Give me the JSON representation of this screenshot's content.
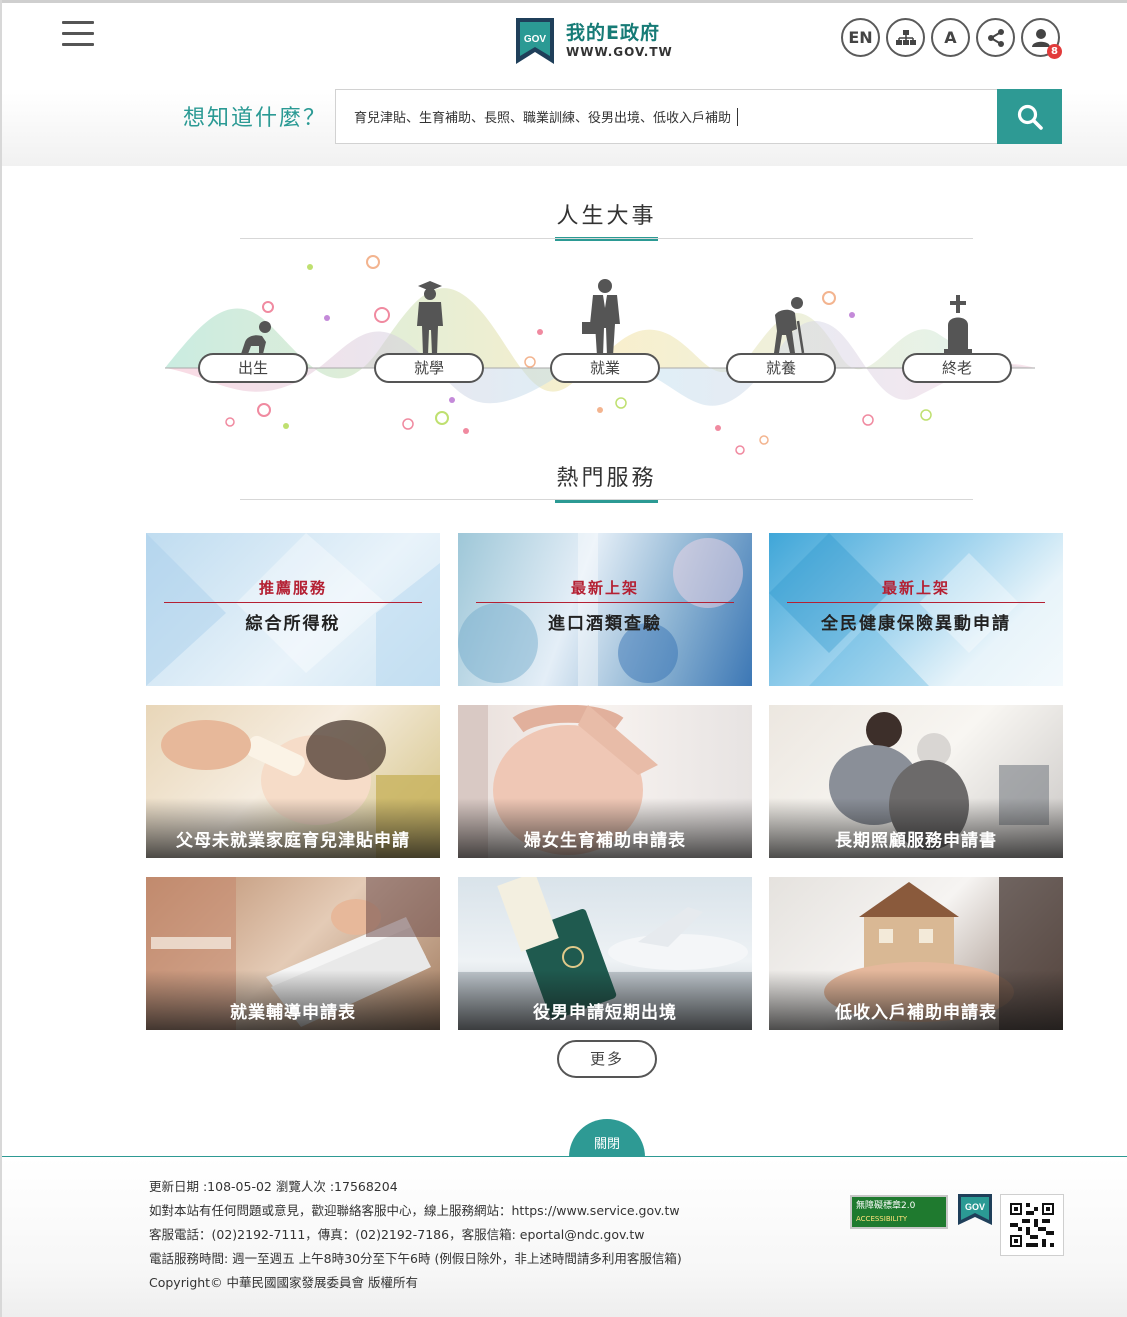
{
  "header": {
    "logo_title": "我的E政府",
    "logo_url": "WWW.GOV.TW",
    "logo_mark": "GOV",
    "tools": {
      "lang_label": "EN",
      "font_label": "A",
      "notification_count": "8"
    },
    "search": {
      "label": "想知道什麼？",
      "value": "育兒津貼、生育補助、長照、職業訓練、役男出境、低收入戶補助"
    }
  },
  "life_events": {
    "title": "人生大事",
    "items": [
      {
        "label": "出生",
        "icon": "baby-icon"
      },
      {
        "label": "就學",
        "icon": "graduate-icon"
      },
      {
        "label": "就業",
        "icon": "worker-icon"
      },
      {
        "label": "就養",
        "icon": "elder-icon"
      },
      {
        "label": "終老",
        "icon": "grave-icon"
      }
    ]
  },
  "popular": {
    "title": "熱門服務",
    "cards": [
      {
        "tag": "推薦服務",
        "title": "綜合所得稅"
      },
      {
        "tag": "最新上架",
        "title": "進口酒類查驗"
      },
      {
        "tag": "最新上架",
        "title": "全民健康保險異動申請"
      },
      {
        "title": "父母未就業家庭育兒津貼申請"
      },
      {
        "title": "婦女生育補助申請表"
      },
      {
        "title": "長期照顧服務申請書"
      },
      {
        "title": "就業輔導申請表"
      },
      {
        "title": "役男申請短期出境"
      },
      {
        "title": "低收入戶補助申請表"
      }
    ],
    "more_label": "更多"
  },
  "footer": {
    "close_label": "關閉",
    "lines": [
      "更新日期 :108-05-02   瀏覽人次 :17568204",
      "如對本站有任何問題或意見，歡迎聯絡客服中心，線上服務網站：https://www.service.gov.tw",
      "客服電話：(02)2192-7111，傳真：(02)2192-7186，客服信箱: eportal@ndc.gov.tw",
      "電話服務時間: 週一至週五  上午8時30分至下午6時  (例假日除外，非上述時間請多利用客服信箱)",
      "Copyright© 中華民國國家發展委員會 版權所有"
    ],
    "accessibility_badge": "無障礙標章2.0",
    "accessibility_sub": "ACCESSIBILITY",
    "gov_badge": "GOV"
  }
}
